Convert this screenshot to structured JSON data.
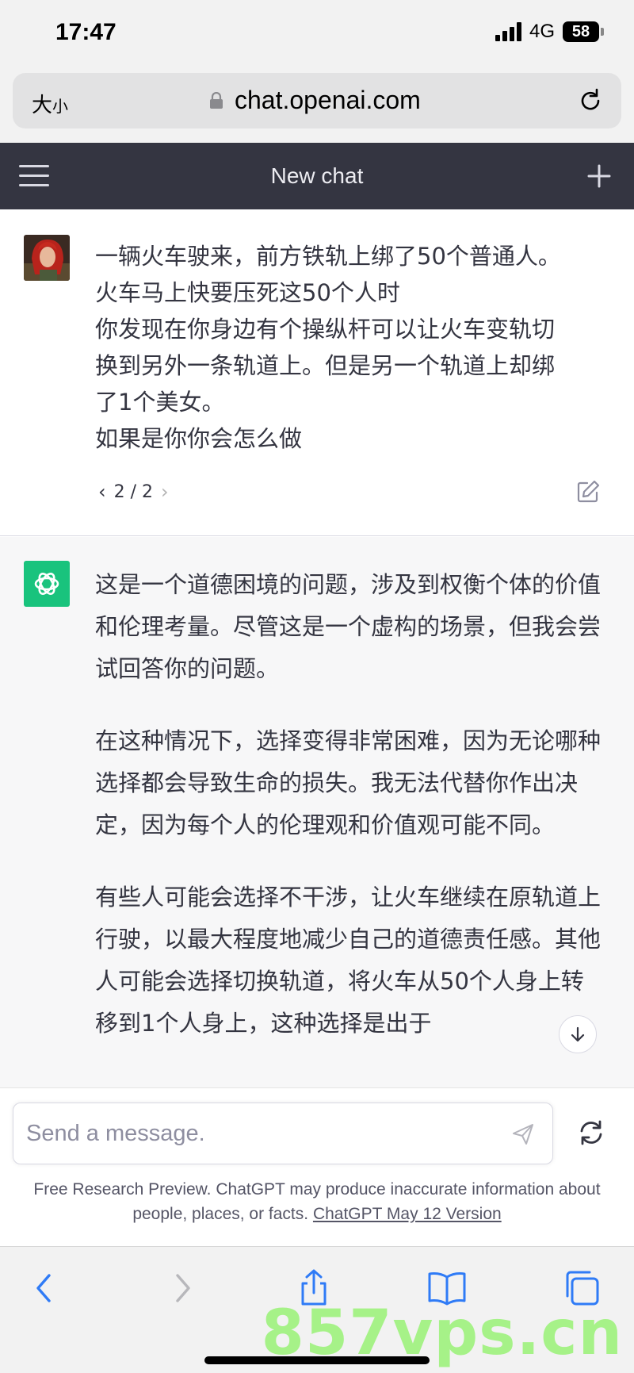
{
  "status_bar": {
    "time": "17:47",
    "network": "4G",
    "battery": "58"
  },
  "browser": {
    "text_size_label": "大",
    "text_size_small": "小",
    "url": "chat.openai.com"
  },
  "app_header": {
    "title": "New chat"
  },
  "user_message": {
    "lines": [
      "一辆火车驶来，前方铁轨上绑了50个普通人。",
      "火车马上快要压死这50个人时",
      "你发现在你身边有个操纵杆可以让火车变轨切",
      "换到另外一条轨道上。但是另一个轨道上却绑",
      "了1个美女。",
      "如果是你你会怎么做"
    ],
    "pager": "2 / 2"
  },
  "assistant_message": {
    "paragraphs": [
      "这是一个道德困境的问题，涉及到权衡个体的价值和伦理考量。尽管这是一个虚构的场景，但我会尝试回答你的问题。",
      "在这种情况下，选择变得非常困难，因为无论哪种选择都会导致生命的损失。我无法代替你作出决定，因为每个人的伦理观和价值观可能不同。",
      "有些人可能会选择不干涉，让火车继续在原轨道上行驶，以最大程度地减少自己的道德责任感。其他人可能会选择切换轨道，将火车从50个人身上转移到1个人身上，这种选择是出于"
    ]
  },
  "composer": {
    "placeholder": "Send a message.",
    "disclaimer_text": "Free Research Preview. ChatGPT may produce inaccurate information about people, places, or facts. ",
    "version_link": "ChatGPT May 12 Version"
  },
  "watermark": "857vps.cn",
  "colors": {
    "header_bg": "#343541",
    "assistant_bg": "#f7f7f8",
    "brand_green": "#19c37d",
    "link_blue": "#2f7bf6"
  },
  "icons": [
    "menu-icon",
    "plus-icon",
    "lock-icon",
    "reload-icon",
    "edit-icon",
    "openai-logo-icon",
    "send-icon",
    "regenerate-icon",
    "back-icon",
    "forward-icon",
    "share-icon",
    "bookmarks-icon",
    "tabs-icon",
    "arrow-down-icon"
  ]
}
